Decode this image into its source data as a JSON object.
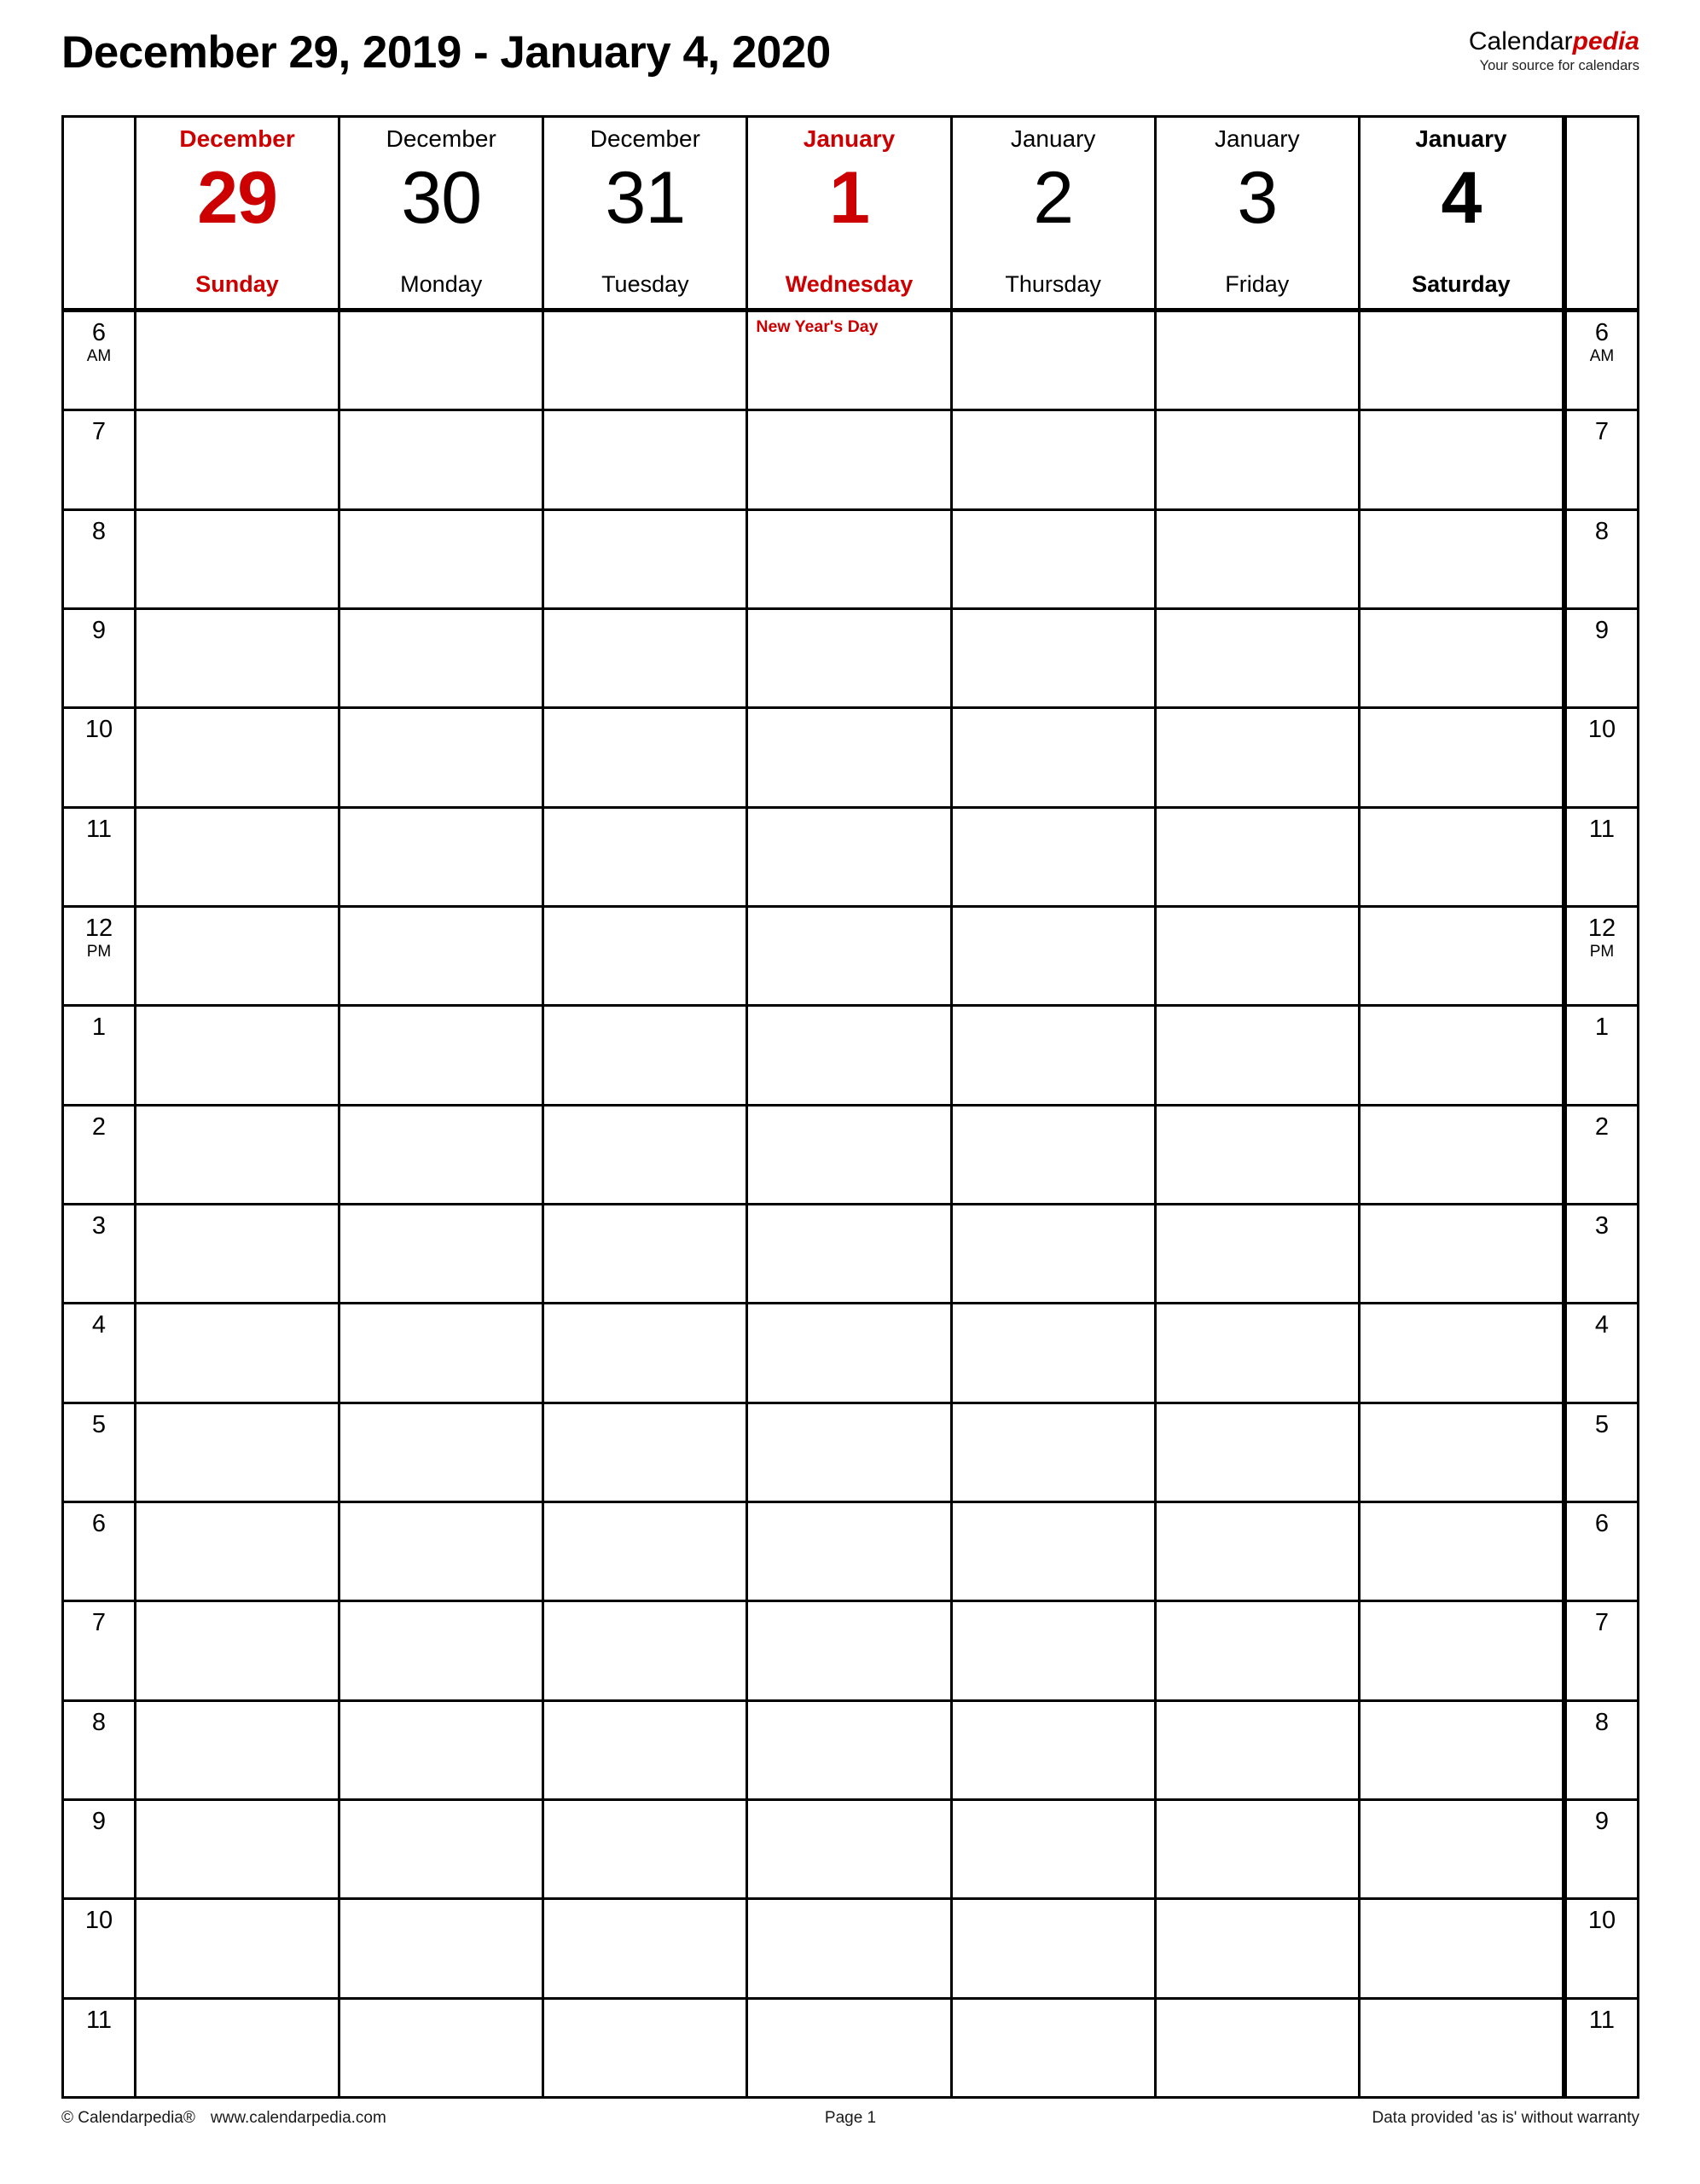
{
  "header": {
    "title": "December 29, 2019 - January 4, 2020",
    "brand_black": "Calendar",
    "brand_red": "pedia",
    "brand_tagline": "Your source for calendars"
  },
  "colors": {
    "accent_red": "#cc0000",
    "text": "#000000",
    "border": "#000000",
    "background": "#ffffff"
  },
  "days": [
    {
      "month": "December",
      "num": "29",
      "dow": "Sunday",
      "weekend": true,
      "holiday": true,
      "event": ""
    },
    {
      "month": "December",
      "num": "30",
      "dow": "Monday",
      "weekend": false,
      "holiday": false,
      "event": ""
    },
    {
      "month": "December",
      "num": "31",
      "dow": "Tuesday",
      "weekend": false,
      "holiday": false,
      "event": ""
    },
    {
      "month": "January",
      "num": "1",
      "dow": "Wednesday",
      "weekend": false,
      "holiday": true,
      "event": "New Year's Day"
    },
    {
      "month": "January",
      "num": "2",
      "dow": "Thursday",
      "weekend": false,
      "holiday": false,
      "event": ""
    },
    {
      "month": "January",
      "num": "3",
      "dow": "Friday",
      "weekend": false,
      "holiday": false,
      "event": ""
    },
    {
      "month": "January",
      "num": "4",
      "dow": "Saturday",
      "weekend": true,
      "holiday": false,
      "event": ""
    }
  ],
  "time_rows": [
    {
      "hour": "6",
      "ampm": "AM"
    },
    {
      "hour": "7",
      "ampm": ""
    },
    {
      "hour": "8",
      "ampm": ""
    },
    {
      "hour": "9",
      "ampm": ""
    },
    {
      "hour": "10",
      "ampm": ""
    },
    {
      "hour": "11",
      "ampm": ""
    },
    {
      "hour": "12",
      "ampm": "PM"
    },
    {
      "hour": "1",
      "ampm": ""
    },
    {
      "hour": "2",
      "ampm": ""
    },
    {
      "hour": "3",
      "ampm": ""
    },
    {
      "hour": "4",
      "ampm": ""
    },
    {
      "hour": "5",
      "ampm": ""
    },
    {
      "hour": "6",
      "ampm": ""
    },
    {
      "hour": "7",
      "ampm": ""
    },
    {
      "hour": "8",
      "ampm": ""
    },
    {
      "hour": "9",
      "ampm": ""
    },
    {
      "hour": "10",
      "ampm": ""
    },
    {
      "hour": "11",
      "ampm": ""
    }
  ],
  "footer": {
    "copyright": "© Calendarpedia®",
    "website": "www.calendarpedia.com",
    "page": "Page 1",
    "disclaimer": "Data provided 'as is' without warranty"
  }
}
